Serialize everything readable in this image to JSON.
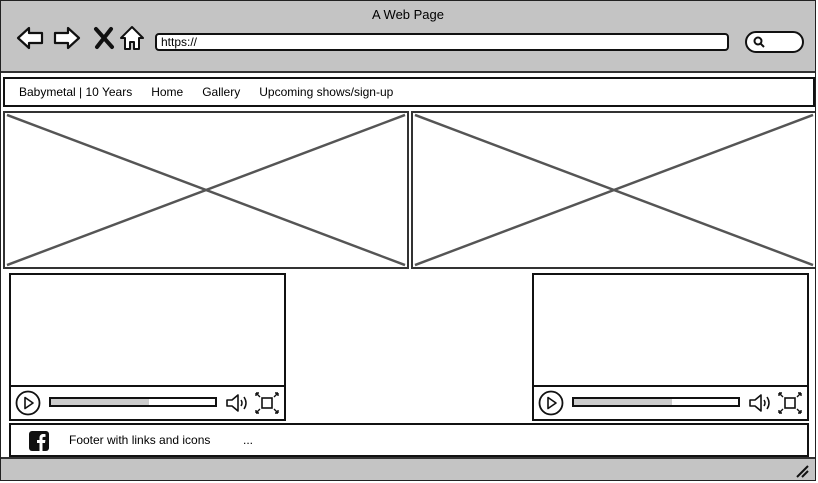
{
  "window": {
    "title": "A Web Page"
  },
  "browser": {
    "url": "https://"
  },
  "navbar": {
    "items": [
      {
        "label": "Babymetal | 10 Years"
      },
      {
        "label": "Home"
      },
      {
        "label": "Gallery"
      },
      {
        "label": "Upcoming shows/sign-up"
      }
    ]
  },
  "videos": [
    {
      "progress": 0.6
    },
    {
      "progress": 0.6
    }
  ],
  "footer": {
    "text": "Footer with links and icons",
    "more": "..."
  },
  "icons": {
    "back": "back-arrow-icon",
    "forward": "forward-arrow-icon",
    "stop": "close-icon",
    "home": "home-icon",
    "search": "search-icon",
    "facebook": "facebook-icon"
  }
}
